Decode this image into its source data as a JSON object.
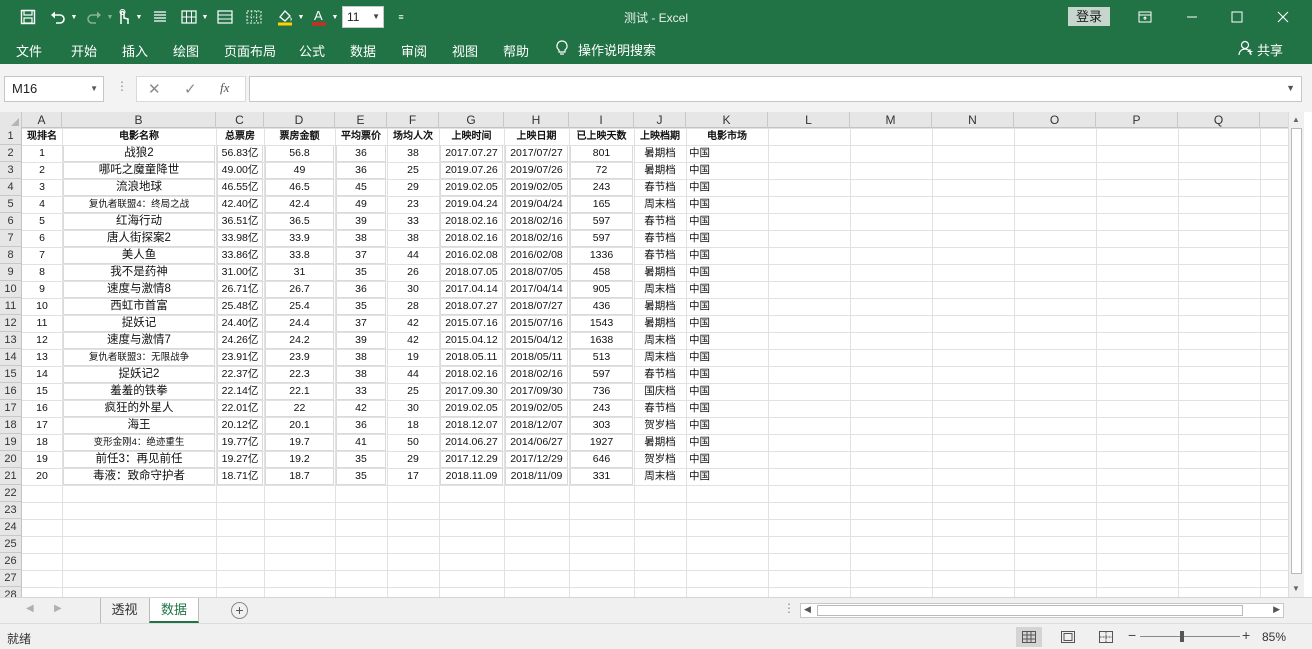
{
  "app": {
    "title": "测试 - Excel",
    "login": "登录"
  },
  "quick_access": {
    "font_size": "11",
    "icons": [
      "save-icon",
      "undo-icon",
      "redo-icon",
      "touch-mode-icon",
      "align-icon",
      "borders-icon",
      "table-icon",
      "format-cells-icon",
      "fill-color-icon",
      "font-color-icon",
      "customize-icon"
    ]
  },
  "menu": [
    "文件",
    "开始",
    "插入",
    "绘图",
    "页面布局",
    "公式",
    "数据",
    "审阅",
    "视图",
    "帮助"
  ],
  "tell_me": "操作说明搜索",
  "share": "共享",
  "formula_bar": {
    "name_box": "M16",
    "formula": "",
    "fx": "fx"
  },
  "columns": [
    "A",
    "B",
    "C",
    "D",
    "E",
    "F",
    "G",
    "H",
    "I",
    "J",
    "K",
    "L",
    "M",
    "N",
    "O",
    "P",
    "Q"
  ],
  "rows": [
    "1",
    "2",
    "3",
    "4",
    "5",
    "6",
    "7",
    "8",
    "9",
    "10",
    "11",
    "12",
    "13",
    "14",
    "15",
    "16",
    "17",
    "18",
    "19",
    "20",
    "21",
    "22",
    "23",
    "24",
    "25",
    "26",
    "27",
    "28"
  ],
  "headers": [
    "现排名",
    "电影名称",
    "总票房",
    "票房金额",
    "平均票价",
    "场均人次",
    "上映时间",
    "上映日期",
    "已上映天数",
    "上映档期",
    "电影市场"
  ],
  "table": [
    [
      "1",
      "战狼2",
      "56.83亿",
      "56.8",
      "36",
      "38",
      "2017.07.27",
      "2017/07/27",
      "801",
      "暑期档",
      "中国"
    ],
    [
      "2",
      "哪吒之魔童降世",
      "49.00亿",
      "49",
      "36",
      "25",
      "2019.07.26",
      "2019/07/26",
      "72",
      "暑期档",
      "中国"
    ],
    [
      "3",
      "流浪地球",
      "46.55亿",
      "46.5",
      "45",
      "29",
      "2019.02.05",
      "2019/02/05",
      "243",
      "春节档",
      "中国"
    ],
    [
      "4",
      "复仇者联盟4：终局之战",
      "42.40亿",
      "42.4",
      "49",
      "23",
      "2019.04.24",
      "2019/04/24",
      "165",
      "周末档",
      "中国"
    ],
    [
      "5",
      "红海行动",
      "36.51亿",
      "36.5",
      "39",
      "33",
      "2018.02.16",
      "2018/02/16",
      "597",
      "春节档",
      "中国"
    ],
    [
      "6",
      "唐人街探案2",
      "33.98亿",
      "33.9",
      "38",
      "38",
      "2018.02.16",
      "2018/02/16",
      "597",
      "春节档",
      "中国"
    ],
    [
      "7",
      "美人鱼",
      "33.86亿",
      "33.8",
      "37",
      "44",
      "2016.02.08",
      "2016/02/08",
      "1336",
      "春节档",
      "中国"
    ],
    [
      "8",
      "我不是药神",
      "31.00亿",
      "31",
      "35",
      "26",
      "2018.07.05",
      "2018/07/05",
      "458",
      "暑期档",
      "中国"
    ],
    [
      "9",
      "速度与激情8",
      "26.71亿",
      "26.7",
      "36",
      "30",
      "2017.04.14",
      "2017/04/14",
      "905",
      "周末档",
      "中国"
    ],
    [
      "10",
      "西虹市首富",
      "25.48亿",
      "25.4",
      "35",
      "28",
      "2018.07.27",
      "2018/07/27",
      "436",
      "暑期档",
      "中国"
    ],
    [
      "11",
      "捉妖记",
      "24.40亿",
      "24.4",
      "37",
      "42",
      "2015.07.16",
      "2015/07/16",
      "1543",
      "暑期档",
      "中国"
    ],
    [
      "12",
      "速度与激情7",
      "24.26亿",
      "24.2",
      "39",
      "42",
      "2015.04.12",
      "2015/04/12",
      "1638",
      "周末档",
      "中国"
    ],
    [
      "13",
      "复仇者联盟3：无限战争",
      "23.91亿",
      "23.9",
      "38",
      "19",
      "2018.05.11",
      "2018/05/11",
      "513",
      "周末档",
      "中国"
    ],
    [
      "14",
      "捉妖记2",
      "22.37亿",
      "22.3",
      "38",
      "44",
      "2018.02.16",
      "2018/02/16",
      "597",
      "春节档",
      "中国"
    ],
    [
      "15",
      "羞羞的铁拳",
      "22.14亿",
      "22.1",
      "33",
      "25",
      "2017.09.30",
      "2017/09/30",
      "736",
      "国庆档",
      "中国"
    ],
    [
      "16",
      "疯狂的外星人",
      "22.01亿",
      "22",
      "42",
      "30",
      "2019.02.05",
      "2019/02/05",
      "243",
      "春节档",
      "中国"
    ],
    [
      "17",
      "海王",
      "20.12亿",
      "20.1",
      "36",
      "18",
      "2018.12.07",
      "2018/12/07",
      "303",
      "贺岁档",
      "中国"
    ],
    [
      "18",
      "变形金刚4：绝迹重生",
      "19.77亿",
      "19.7",
      "41",
      "50",
      "2014.06.27",
      "2014/06/27",
      "1927",
      "暑期档",
      "中国"
    ],
    [
      "19",
      "前任3：再见前任",
      "19.27亿",
      "19.2",
      "35",
      "29",
      "2017.12.29",
      "2017/12/29",
      "646",
      "贺岁档",
      "中国"
    ],
    [
      "20",
      "毒液：致命守护者",
      "18.71亿",
      "18.7",
      "35",
      "17",
      "2018.11.09",
      "2018/11/09",
      "331",
      "周末档",
      "中国"
    ]
  ],
  "sheets": [
    "透视",
    "数据"
  ],
  "active_sheet": "数据",
  "status": {
    "text": "就绪",
    "zoom": "85%"
  },
  "colors": {
    "accent": "#217346"
  }
}
